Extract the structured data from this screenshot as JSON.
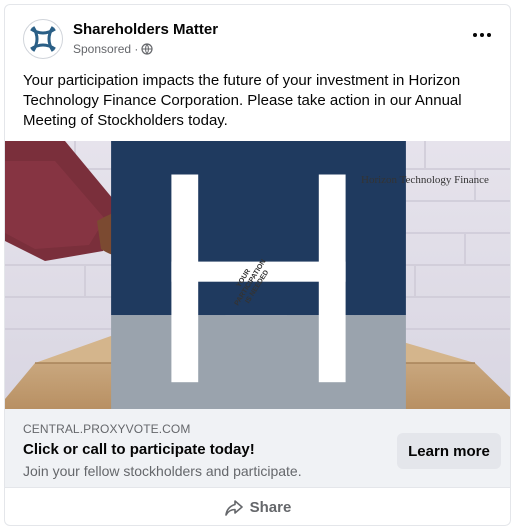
{
  "post": {
    "page_name": "Shareholders Matter",
    "sponsored_label": "Sponsored ·",
    "icons": {
      "privacy": "globe-icon",
      "menu": "more-dots-icon",
      "share": "share-arrow-icon",
      "avatar": "shareholders-logo"
    },
    "text": "Your participation impacts the future of your investment in Horizon Technology Finance Corporation. Please take action in our Annual Meeting of Stockholders today."
  },
  "creative": {
    "brand_name": "Horizon Technology Finance",
    "ballot_text": "YOUR PARTICIPATION IS NEEDED"
  },
  "link": {
    "domain": "CENTRAL.PROXYVOTE.COM",
    "title": "Click or call to participate today!",
    "description": "Join your fellow stockholders and participate.",
    "cta_label": "Learn more"
  },
  "footer": {
    "share_label": "Share"
  },
  "colors": {
    "text_primary": "#050505",
    "text_secondary": "#65676b",
    "link_background": "#f0f2f5",
    "button_background": "#e4e6eb",
    "brand_navy": "#1f3a5f"
  }
}
